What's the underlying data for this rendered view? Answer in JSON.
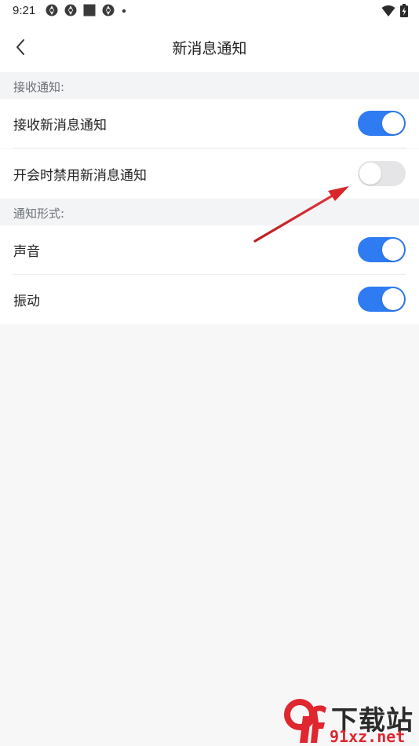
{
  "status_bar": {
    "time": "9:21",
    "left_icons": [
      "app-notification-icon",
      "app-notification-icon",
      "square-notification-icon",
      "app-notification-icon",
      "dot-icon"
    ],
    "right_icons": [
      "wifi-icon",
      "battery-charging-icon"
    ]
  },
  "nav": {
    "title": "新消息通知",
    "back_icon": "chevron-left-icon"
  },
  "sections": [
    {
      "header": "接收通知:",
      "rows": [
        {
          "label": "接收新消息通知",
          "enabled": true
        },
        {
          "label": "开会时禁用新消息通知",
          "enabled": false
        }
      ]
    },
    {
      "header": "通知形式:",
      "rows": [
        {
          "label": "声音",
          "enabled": true
        },
        {
          "label": "振动",
          "enabled": true
        }
      ]
    }
  ],
  "colors": {
    "accent": "#2f7bf2",
    "toggle_off": "#e5e5e7",
    "annotation_arrow": "#d8262b"
  },
  "watermark": {
    "logo_text": "9f",
    "brand_text": "下载站",
    "url_text": "91xz.net"
  }
}
